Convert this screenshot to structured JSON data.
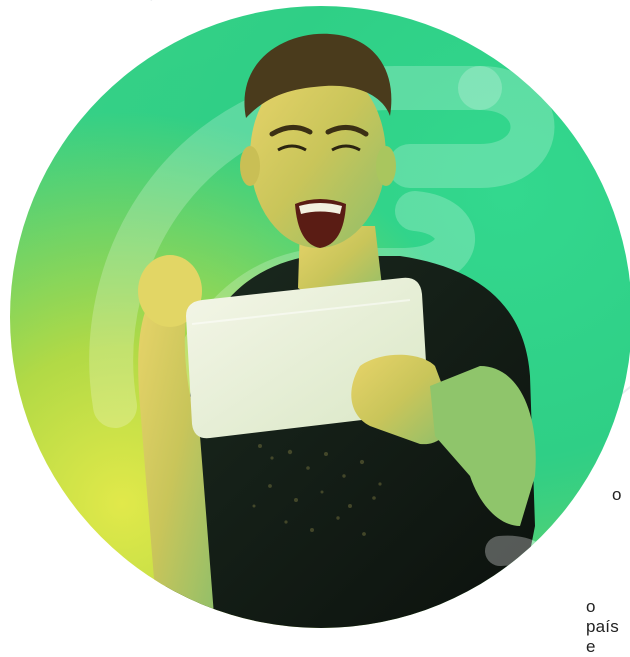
{
  "hero": {
    "subject": "person-with-tablet",
    "accent_colors": [
      "#2ecf85",
      "#d9e64a",
      "#111111"
    ]
  },
  "snippets": {
    "line1": "o",
    "line2": "o país e"
  }
}
